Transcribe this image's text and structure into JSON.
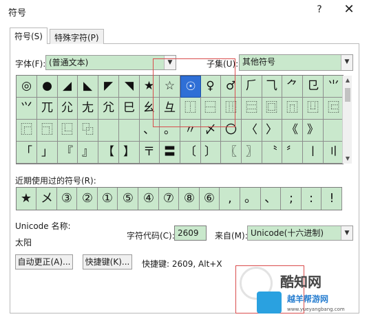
{
  "window": {
    "title": "符号",
    "help": "?",
    "close": "✕"
  },
  "tabs": [
    {
      "label": "符号(S)"
    },
    {
      "label": "特殊字符(P)"
    }
  ],
  "font": {
    "label": "字体(F):",
    "value": "(普通文本)"
  },
  "subset": {
    "label": "子集(U):",
    "value": "其他符号"
  },
  "symbol_rows": [
    [
      "◎",
      "●",
      "◢",
      "◣",
      "◤",
      "◥",
      "★",
      "☆",
      "☉",
      "♀",
      "♂",
      "⺁",
      "⺄",
      "⺈",
      "⺋",
      "⺌"
    ],
    [
      "⺍",
      "⺎",
      "⺏",
      "⺐",
      "⺑",
      "⺒",
      "⺓",
      "⺔",
      "⿰",
      "⿱",
      "⿲",
      "⿳",
      "⿴",
      "⿵",
      "⿶",
      "⿷"
    ],
    [
      "⿸",
      "⿹",
      "⿺",
      "⿻",
      "",
      "",
      "、",
      "。",
      "〃",
      "〆",
      "〇",
      "〈",
      "〉",
      "《",
      "》",
      ""
    ],
    [
      "「",
      "」",
      "『",
      "』",
      "【",
      "】",
      "〒",
      "〓",
      "〔",
      "〕",
      "〖",
      "〗",
      "〝",
      "〞",
      "〡",
      "〢"
    ]
  ],
  "recent": {
    "label": "近期使用过的符号(R):",
    "symbols": [
      "★",
      "メ",
      "③",
      "②",
      "①",
      "⑤",
      "④",
      "⑦",
      "⑧",
      "⑥",
      ",",
      "。",
      "、",
      ";",
      ":",
      "!"
    ]
  },
  "unicode_name": {
    "label": "Unicode 名称:",
    "value": "太阳"
  },
  "char_code": {
    "label": "字符代码(C):",
    "value": "2609"
  },
  "from": {
    "label": "来自(M):",
    "value": "Unicode(十六进制)"
  },
  "buttons": {
    "autocorrect": "自动更正(A)...",
    "shortcut_key": "快捷键(K)..."
  },
  "shortcut_text": "快捷键: 2609, Alt+X",
  "watermark": {
    "brand": "酷知网",
    "sub": "越羊帮游网",
    "url": "www.yueyangbang.com"
  }
}
